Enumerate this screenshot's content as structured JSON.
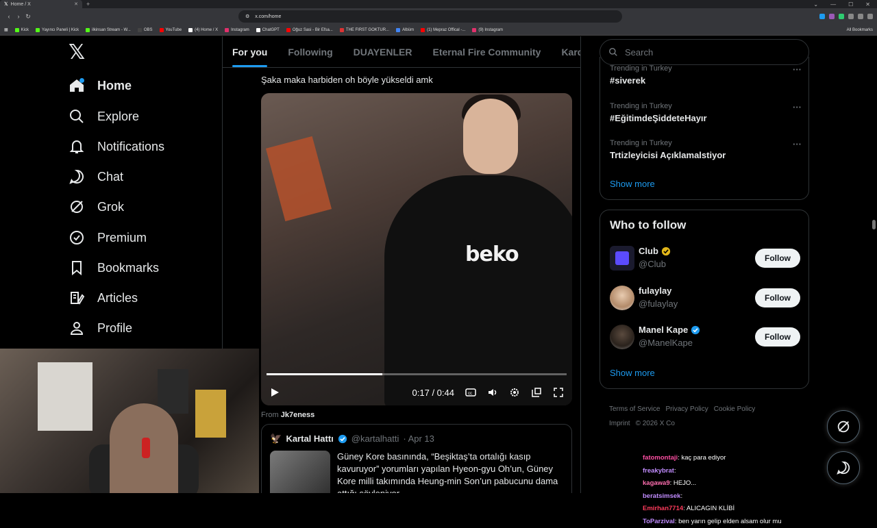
{
  "browser": {
    "tab_title": "Home / X",
    "url": "x.com/home",
    "bookmarks": [
      "Kick",
      "Yayıncı Paneli | Kick",
      "ilkinsan Stream - W...",
      "OBS",
      "YouTube",
      "(4) Home / X",
      "Instagram",
      "ChatGPT",
      "Oğuz Sasi - Bir Efsa...",
      "THE FIRST GOKTUR...",
      "Albüm",
      "(1) Mepraz Offical -...",
      "(9) Instagram"
    ],
    "all_bookmarks": "All Bookmarks"
  },
  "sidebar": {
    "items": [
      {
        "label": "Home"
      },
      {
        "label": "Explore"
      },
      {
        "label": "Notifications"
      },
      {
        "label": "Chat"
      },
      {
        "label": "Grok"
      },
      {
        "label": "Premium"
      },
      {
        "label": "Bookmarks"
      },
      {
        "label": "Articles"
      },
      {
        "label": "Profile"
      }
    ]
  },
  "feed": {
    "tabs": [
      "For you",
      "Following",
      "DUAYENLER",
      "Eternal Fire Community",
      "Kardeşler Ku"
    ],
    "post_text": "Şaka maka harbiden oh böyle yükseldi amk",
    "video": {
      "time": "0:17 / 0:44",
      "progress": 0.386,
      "jersey_text": "beko"
    },
    "from_label": "From",
    "from_user": "Jk7eness",
    "quote": {
      "name": "Kartal Hattı",
      "handle": "@kartalhatti",
      "date": "· Apr 13",
      "text": "Güney Kore basınında, “Beşiktaş’ta ortalığı kasıp kavuruyor” yorumları yapılan Hyeon-gyu Oh’un, Güney Kore milli takımında Heung-min Son’un pabucunu dama attığı söyleniyor"
    }
  },
  "right": {
    "search_placeholder": "Search",
    "trends": [
      {
        "context": "Trending in Turkey",
        "tag": "#siverek"
      },
      {
        "context": "Trending in Turkey",
        "tag": "#EğitimdeŞiddeteHayır"
      },
      {
        "context": "Trending in Turkey",
        "tag": "Trtizleyicisi Açıklamalstiyor"
      }
    ],
    "show_more": "Show more",
    "who_to_follow": {
      "title": "Who to follow",
      "accounts": [
        {
          "name": "Club",
          "handle": "@Club",
          "badge": "gold",
          "button": "Follow"
        },
        {
          "name": "fulaylay",
          "handle": "@fulaylay",
          "badge": "none",
          "button": "Follow"
        },
        {
          "name": "Manel Kape",
          "handle": "@ManelKape",
          "badge": "blue",
          "button": "Follow"
        }
      ],
      "show_more": "Show more"
    },
    "footer": [
      "Terms of Service",
      "Privacy Policy",
      "Cookie Policy",
      "Imprint",
      "© 2026 X Co"
    ]
  },
  "stream_chat": [
    {
      "user": "fatomontaji",
      "msg": "kaç para ediyor",
      "color": "#ff4fa3"
    },
    {
      "user": "freakybrat",
      "msg": "",
      "color": "#c18cff"
    },
    {
      "user": "kagawa9",
      "msg": "HEJO...",
      "color": "#ff6fb0"
    },
    {
      "user": "beratsimsek",
      "msg": "",
      "color": "#c18cff"
    },
    {
      "user": "Emirhan7714",
      "msg": "ALICAGIN KLİBİ",
      "color": "#ff3b5c"
    },
    {
      "user": "ToParzival",
      "msg": "ben yarın gelip elden alsam olur mu",
      "color": "#c18cff"
    }
  ],
  "colors": {
    "accent": "#1d9bf0",
    "background": "#000000",
    "border": "#2f3336",
    "muted": "#71767b"
  }
}
